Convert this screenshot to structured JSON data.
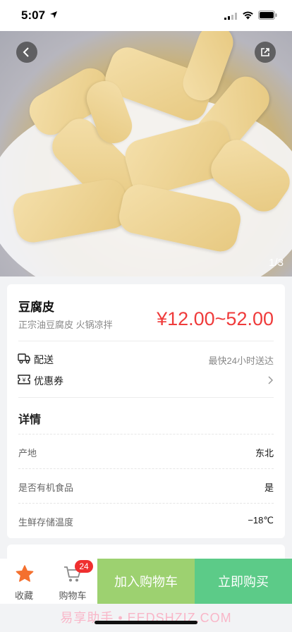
{
  "status_bar": {
    "time": "5:07"
  },
  "hero": {
    "pager": "1/3"
  },
  "product": {
    "name": "豆腐皮",
    "subtitle": "正宗油豆腐皮 火锅凉拌",
    "price": "¥12.00~52.00"
  },
  "delivery": {
    "label": "配送",
    "value": "最快24小时送达"
  },
  "coupon": {
    "label": "优惠券"
  },
  "details": {
    "title": "详情",
    "rows": [
      {
        "key": "产地",
        "value": "东北"
      },
      {
        "key": "是否有机食品",
        "value": "是"
      },
      {
        "key": "生鲜存储温度",
        "value": "−18℃"
      }
    ]
  },
  "bottom_bar": {
    "fav_label": "收藏",
    "cart_label": "购物车",
    "cart_count": "24",
    "add_to_cart": "加入购物车",
    "buy_now": "立即购买"
  },
  "watermark": "易享助手 • EEDSHZIZ.COM",
  "colors": {
    "price": "#ef3b3b",
    "add_button": "#9dd170",
    "buy_button": "#5ccb88",
    "star": "#f4702e"
  }
}
